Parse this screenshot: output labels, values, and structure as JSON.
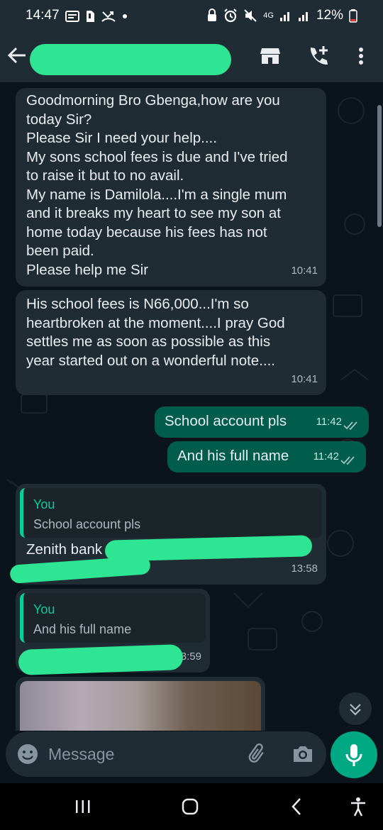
{
  "status_bar": {
    "time": "14:47",
    "network": "4G",
    "battery": "12%"
  },
  "header": {
    "contact_name": "",
    "icons": [
      "back-arrow",
      "store-icon",
      "add-call-icon",
      "more-vert-icon"
    ]
  },
  "messages": [
    {
      "direction": "incoming",
      "text": "Goodmorning Bro Gbenga,how are you\ntoday Sir?\nPlease Sir I need your help....\nMy sons school fees is due and I've tried\nto raise it but to no avail.\nMy name is Damilola....I'm a single mum\nand it breaks my heart to see my son at\nhome today because his fees has not\nbeen paid.\nPlease help me Sir",
      "time": "10:41"
    },
    {
      "direction": "incoming",
      "text": "His school fees is N66,000...I'm so\nheartbroken at the moment....I pray God\nsettles me as soon as possible as this\nyear started out on a wonderful note....",
      "time": "10:41"
    },
    {
      "direction": "outgoing",
      "text": "School account pls",
      "time": "11:42",
      "status": "read"
    },
    {
      "direction": "outgoing",
      "text": "And his full name",
      "time": "11:42",
      "status": "read"
    },
    {
      "direction": "incoming",
      "quote": {
        "author": "You",
        "text": "School account pls"
      },
      "text": "Zenith bank",
      "time": "13:58"
    },
    {
      "direction": "incoming",
      "quote": {
        "author": "You",
        "text": "And his full name"
      },
      "text": "",
      "time": "3:59"
    }
  ],
  "input": {
    "placeholder": "Message"
  },
  "colors": {
    "background": "#0b141a",
    "bar": "#1f2c34",
    "incoming_bubble": "#202c33",
    "outgoing_bubble": "#005c4b",
    "accent": "#00a884",
    "quote_accent": "#06cf9c",
    "read_ticks": "#a5c3bf",
    "redaction": "#2ee594"
  }
}
